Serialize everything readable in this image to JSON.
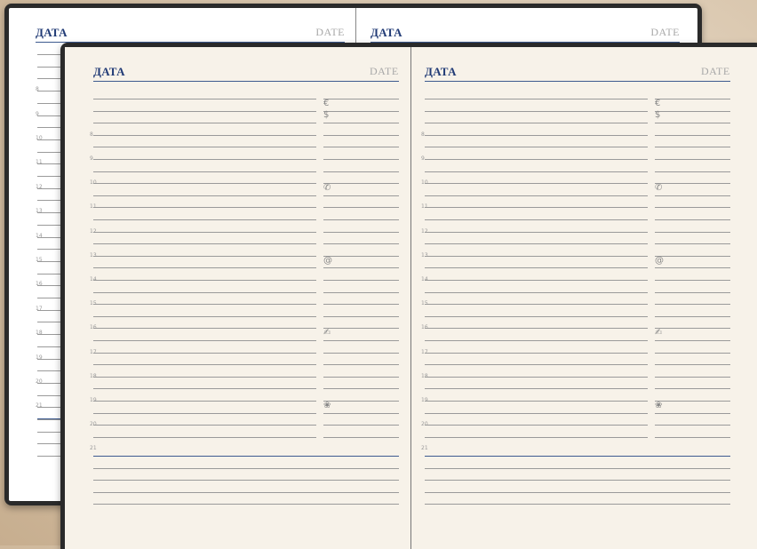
{
  "header": {
    "left_label": "ДАТА",
    "right_label": "DATE"
  },
  "hours": [
    "8",
    "9",
    "10",
    "11",
    "12",
    "13",
    "14",
    "15",
    "16",
    "17",
    "18",
    "19",
    "20",
    "21"
  ],
  "side_symbols": [
    {
      "name": "euro-icon",
      "glyph": "€"
    },
    {
      "name": "dollar-icon",
      "glyph": "$"
    },
    {
      "name": "phone-icon",
      "glyph": "✆"
    },
    {
      "name": "at-sign-icon",
      "glyph": "@"
    },
    {
      "name": "pen-icon",
      "glyph": "✍"
    },
    {
      "name": "flower-icon",
      "glyph": "❀"
    }
  ]
}
